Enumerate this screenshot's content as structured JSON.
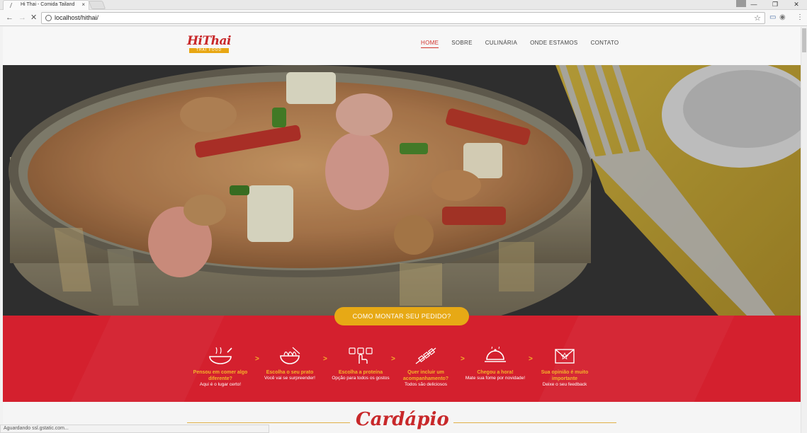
{
  "browser": {
    "tab_title": "Hi Thai - Comida Tailand",
    "tab_close": "×",
    "url": "localhost/hithai/",
    "window_controls": [
      "—",
      "❐",
      "✕"
    ],
    "status_text": "Aguardando ssl.gstatic.com..."
  },
  "site": {
    "logo_text": "HiThai",
    "logo_sub": "THAI FOOD",
    "nav": [
      "HOME",
      "SOBRE",
      "CULINÁRIA",
      "ONDE ESTAMOS",
      "CONTATO"
    ],
    "active_nav": "HOME",
    "cta_label": "COMO MONTAR SEU PEDIDO?",
    "steps": [
      {
        "title": "Pensou em comer algo diferente?",
        "subtitle": "Aqui é o lugar certo!",
        "icon": "wok-icon"
      },
      {
        "title": "Escolha o seu prato",
        "subtitle": "Você vai se surpreender!",
        "icon": "noodle-bowl-icon"
      },
      {
        "title": "Escolha a proteína",
        "subtitle": "Opção para todos os gostos",
        "icon": "choice-icon"
      },
      {
        "title": "Quer incluir um acompanhamento?",
        "subtitle": "Todos são deliciosos",
        "icon": "skewer-icon"
      },
      {
        "title": "Chegou a hora!",
        "subtitle": "Mate sua fome por novidade!",
        "icon": "cloche-icon"
      },
      {
        "title": "Sua opinião é muito importante",
        "subtitle": "Deixe o seu feedback",
        "icon": "envelope-icon"
      }
    ],
    "step_arrow": ">",
    "section_title": "Cardápio"
  },
  "colors": {
    "brand_red": "#d4202e",
    "brand_yellow": "#e7a915",
    "accent_text_yellow": "#f4b42a"
  }
}
